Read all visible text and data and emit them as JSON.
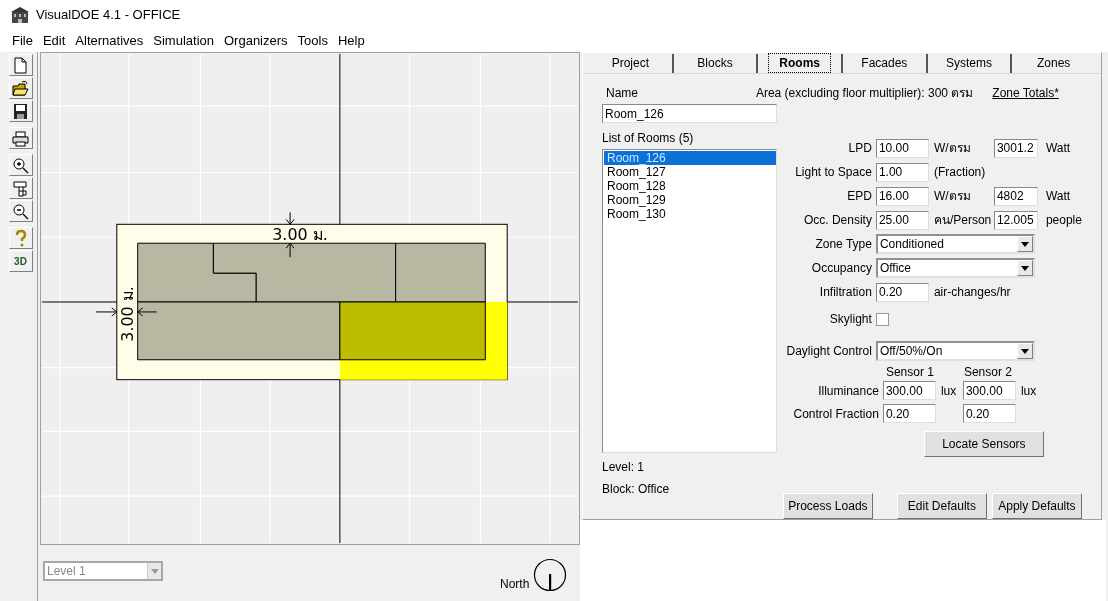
{
  "window": {
    "title": "VisualDOE 4.1 - OFFICE"
  },
  "menu": [
    "File",
    "Edit",
    "Alternatives",
    "Simulation",
    "Organizers",
    "Tools",
    "Help"
  ],
  "toolbar": [
    {
      "kind": "new"
    },
    {
      "kind": "open"
    },
    {
      "kind": "save"
    },
    {
      "kind": "print"
    },
    {
      "kind": "zoom_in"
    },
    {
      "kind": "pan"
    },
    {
      "kind": "zoom_out"
    },
    {
      "kind": "help"
    },
    {
      "kind": "view3d",
      "label": "3D"
    }
  ],
  "plan": {
    "dimension_top": "3.00 ม.",
    "dimension_left": "3.00 ม.",
    "rooms": [
      {
        "selected": false
      },
      {
        "selected": false
      },
      {
        "selected": false
      },
      {
        "selected": false
      },
      {
        "selected": true
      }
    ]
  },
  "level_select": {
    "value": "Level 1",
    "disabled": true
  },
  "compass": {
    "label": "North"
  },
  "tabs": [
    {
      "label": "Project",
      "selected": false
    },
    {
      "label": "Blocks",
      "selected": false
    },
    {
      "label": "Rooms",
      "selected": true
    },
    {
      "label": "Facades",
      "selected": false
    },
    {
      "label": "Systems",
      "selected": false
    },
    {
      "label": "Zones",
      "selected": false
    }
  ],
  "name_label": "Name",
  "name_value": "Room_126",
  "area_text": "Area (excluding floor multiplier): 300 ตรม",
  "zone_totals_link": "Zone Totals*",
  "rooms_label": "List of Rooms (5)",
  "rooms": [
    {
      "name": "Room_126",
      "selected": true
    },
    {
      "name": "Room_127",
      "selected": false
    },
    {
      "name": "Room_128",
      "selected": false
    },
    {
      "name": "Room_129",
      "selected": false
    },
    {
      "name": "Room_130",
      "selected": false
    }
  ],
  "level_info": "Level: 1",
  "block_info": "Block: Office",
  "room_fields": [
    {
      "kind": "input",
      "label": "LPD",
      "value": "10.00",
      "unit": "W/ตรม",
      "total": "3001.2",
      "total_unit": "Watt"
    },
    {
      "kind": "input",
      "label": "Light to Space",
      "value": "1.00",
      "unit": "(Fraction)"
    },
    {
      "kind": "input",
      "label": "EPD",
      "value": "16.00",
      "unit": "W/ตรม",
      "total": "4802",
      "total_unit": "Watt"
    },
    {
      "kind": "input",
      "label": "Occ. Density",
      "value": "25.00",
      "unit": "คน/Person",
      "total": "12.005",
      "total_unit": "people"
    },
    {
      "kind": "select",
      "label": "Zone Type",
      "value": "Conditioned"
    },
    {
      "kind": "select",
      "label": "Occupancy",
      "value": "Office"
    },
    {
      "kind": "input",
      "label": "Infiltration",
      "value": "0.20",
      "unit": "air-changes/hr"
    },
    {
      "kind": "checkbox",
      "label": "Skylight",
      "checked": false
    },
    {
      "kind": "select",
      "label": "Daylight Control",
      "value": "Off/50%/On"
    }
  ],
  "sensors": {
    "headers": [
      "Sensor 1",
      "Sensor 2"
    ],
    "rows": [
      {
        "label": "Illuminance",
        "values": [
          "300.00",
          "300.00"
        ],
        "units": [
          "lux",
          "lux"
        ]
      },
      {
        "label": "Control Fraction",
        "values": [
          "0.20",
          "0.20"
        ]
      }
    ]
  },
  "locate_button": "Locate Sensors",
  "bottom_buttons": [
    "Process Loads",
    "Edit Defaults",
    "Apply Defaults"
  ]
}
